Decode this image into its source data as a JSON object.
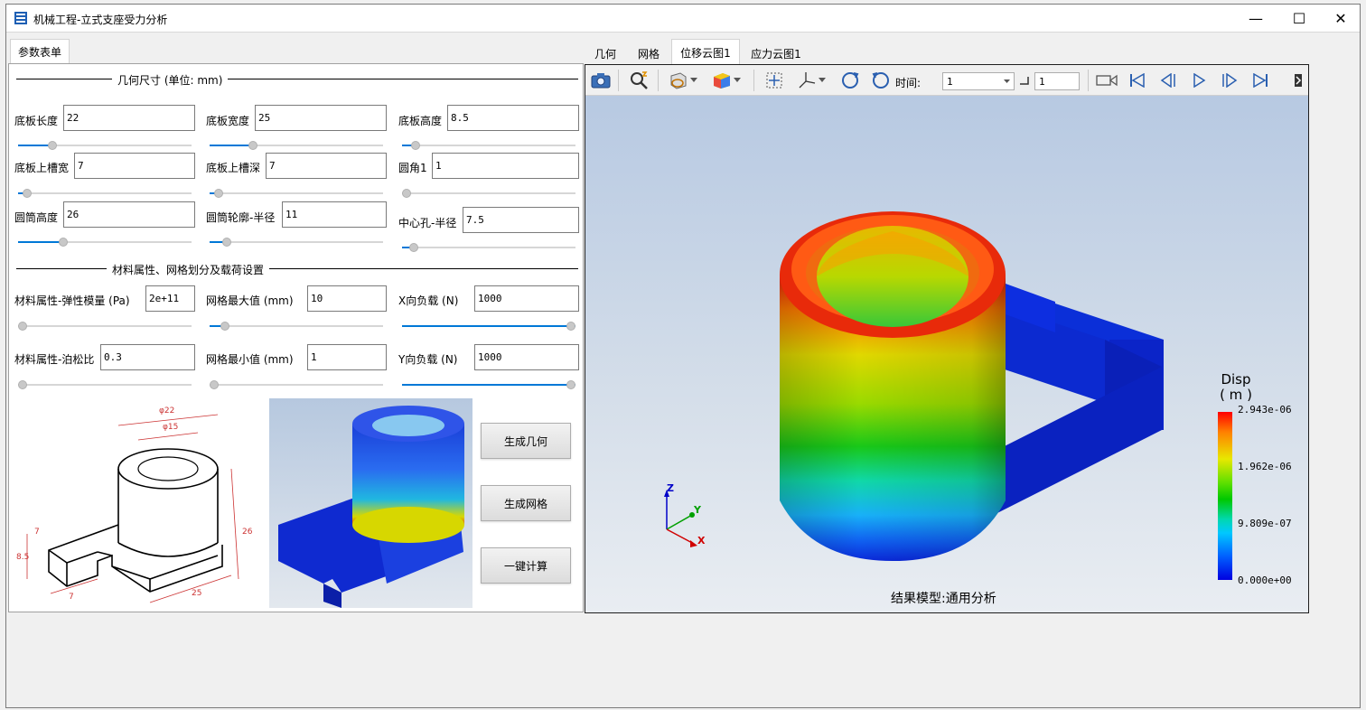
{
  "window": {
    "title": "机械工程-立式支座受力分析",
    "minimize": "—",
    "maximize": "☐",
    "close": "✕"
  },
  "left_tab": "参数表单",
  "geometry_section": {
    "title": "几何尺寸 (单位: mm)",
    "fields": [
      {
        "label": "底板长度",
        "value": "22",
        "slider": 0.2
      },
      {
        "label": "底板宽度",
        "value": "25",
        "slider": 0.25
      },
      {
        "label": "底板高度",
        "value": "8.5",
        "slider": 0.08
      },
      {
        "label": "底板上槽宽",
        "value": "7",
        "slider": 0.05
      },
      {
        "label": "底板上槽深",
        "value": "7",
        "slider": 0.05
      },
      {
        "label": "圆角1",
        "value": "1",
        "slider": 0.0
      },
      {
        "label": "圆筒高度",
        "value": "26",
        "slider": 0.26
      },
      {
        "label": "圆筒轮廓-半径",
        "value": "11",
        "slider": 0.1
      },
      {
        "label": "中心孔-半径",
        "value": "7.5",
        "slider": 0.07
      }
    ]
  },
  "material_section": {
    "title": "材料属性、网格划分及载荷设置",
    "fields": [
      {
        "label": "材料属性-弹性模量 (Pa)",
        "value": "2e+11",
        "slider": 0.0
      },
      {
        "label": "网格最大值 (mm)",
        "value": "10",
        "slider": 0.09
      },
      {
        "label": "X向负载 (N)",
        "value": "1000",
        "slider": 1.0
      },
      {
        "label": "材料属性-泊松比",
        "value": "0.3",
        "slider": 0.0
      },
      {
        "label": "网格最小值 (mm)",
        "value": "1",
        "slider": 0.0
      },
      {
        "label": "Y向负载 (N)",
        "value": "1000",
        "slider": 1.0
      }
    ]
  },
  "drawing_dims": {
    "d1": "φ22",
    "d2": "φ15",
    "d3": "26",
    "d4": "25",
    "d5": "7",
    "d6": "8.5",
    "d7": "7"
  },
  "buttons": {
    "gen_geometry": "生成几何",
    "gen_mesh": "生成网格",
    "compute": "一键计算"
  },
  "right_tabs": [
    "几何",
    "网格",
    "位移云图1",
    "应力云图1"
  ],
  "active_right_tab": 2,
  "toolbar": {
    "time_label": "时间:",
    "time_value": "1",
    "step_value": "1"
  },
  "legend": {
    "title_line1": "Disp",
    "title_line2": "( m )",
    "ticks": [
      "2.943e-06",
      "1.962e-06",
      "9.809e-07",
      "0.000e+00"
    ]
  },
  "axes": {
    "x": "X",
    "y": "Y",
    "z": "Z"
  },
  "result_caption": "结果模型:通用分析",
  "colors": {
    "accent": "#0078d7",
    "viewer_bg_top": "#b7c9e2",
    "viewer_bg_bottom": "#e9edf2"
  }
}
